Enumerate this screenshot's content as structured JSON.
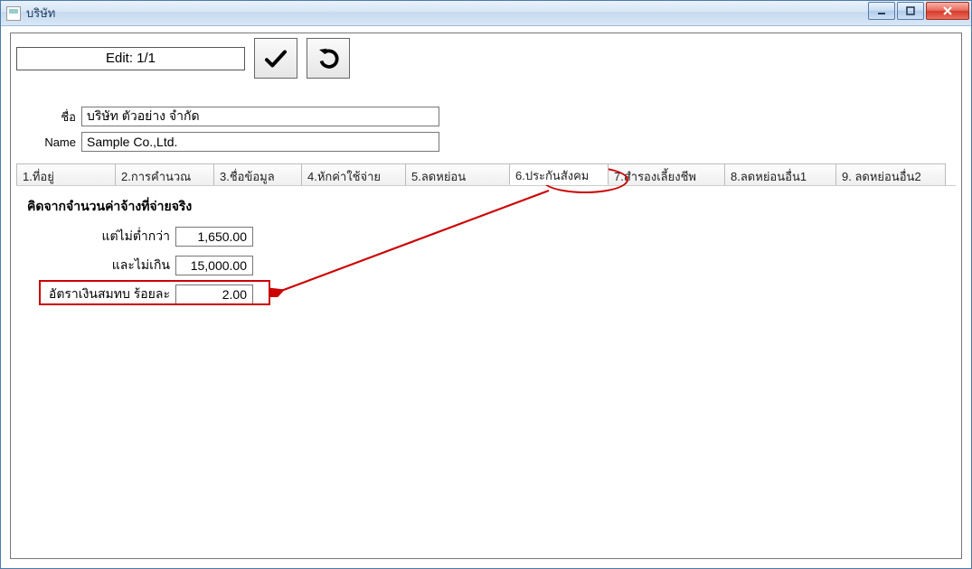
{
  "window": {
    "title": "บริษัท"
  },
  "toolbar": {
    "edit_status": "Edit: 1/1"
  },
  "name": {
    "label_th": "ชื่อ",
    "label_en": "Name",
    "value_th": "บริษัท ตัวอย่าง จำกัด",
    "value_en": "Sample Co.,Ltd."
  },
  "tabs": [
    {
      "label": "1.ที่อยู่"
    },
    {
      "label": "2.การคำนวณ"
    },
    {
      "label": "3.ชื่อข้อมูล"
    },
    {
      "label": "4.หักค่าใช้จ่าย"
    },
    {
      "label": "5.ลดหย่อน"
    },
    {
      "label": "6.ประกันสังคม"
    },
    {
      "label": "7.สำรองเลี้ยงชีพ"
    },
    {
      "label": "8.ลดหย่อนอื่น1"
    },
    {
      "label": "9. ลดหย่อนอื่น2"
    }
  ],
  "active_tab_index": 5,
  "panel": {
    "heading": "คิดจากจำนวนค่าจ้างที่จ่ายจริง",
    "rows": [
      {
        "label": "แต่ไม่ต่ำกว่า",
        "value": "1,650.00"
      },
      {
        "label": "และไม่เกิน",
        "value": "15,000.00"
      },
      {
        "label": "อัตราเงินสมทบ ร้อยละ",
        "value": "2.00"
      }
    ]
  }
}
